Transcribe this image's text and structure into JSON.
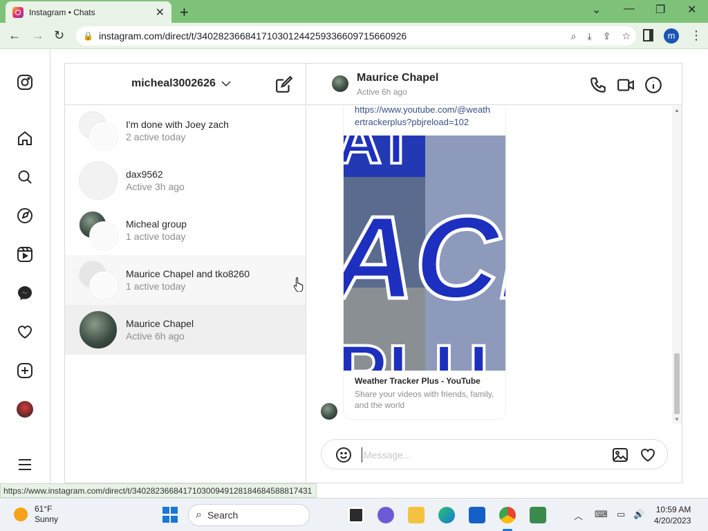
{
  "browser": {
    "tab_title": "Instagram • Chats",
    "url": "instagram.com/direct/t/340282366841710301244259336609715660926",
    "status_link": "https://www.instagram.com/direct/t/340282366841710300949128184684588817431",
    "profile_initial": "m"
  },
  "inbox": {
    "account": "micheal3002626",
    "threads": [
      {
        "name": "I'm done with Joey zach",
        "sub": "2 active today"
      },
      {
        "name": "dax9562",
        "sub": "Active 3h ago"
      },
      {
        "name": "Micheal group",
        "sub": "1 active today"
      },
      {
        "name": "Maurice Chapel and tko8260",
        "sub": "1 active today"
      },
      {
        "name": "Maurice Chapel",
        "sub": "Active 6h ago"
      }
    ]
  },
  "chat": {
    "name": "Maurice Chapel",
    "status": "Active 6h ago",
    "link_text": "https://www.youtube.com/@weathertrackerplus?pbjreload=102",
    "preview_title": "Weather Tracker Plus - YouTube",
    "preview_desc": "Share your videos with friends, family, and the world",
    "composer_placeholder": "Message..."
  },
  "taskbar": {
    "temp": "61°F",
    "condition": "Sunny",
    "search_label": "Search",
    "time": "10:59 AM",
    "date": "4/20/2023"
  },
  "colors": {
    "chrome_frame": "#7ec27a",
    "chrome_toolbar": "#e9f3e7",
    "selected_thread": "#efefef",
    "youtube_blue": "#1d3bb0"
  }
}
